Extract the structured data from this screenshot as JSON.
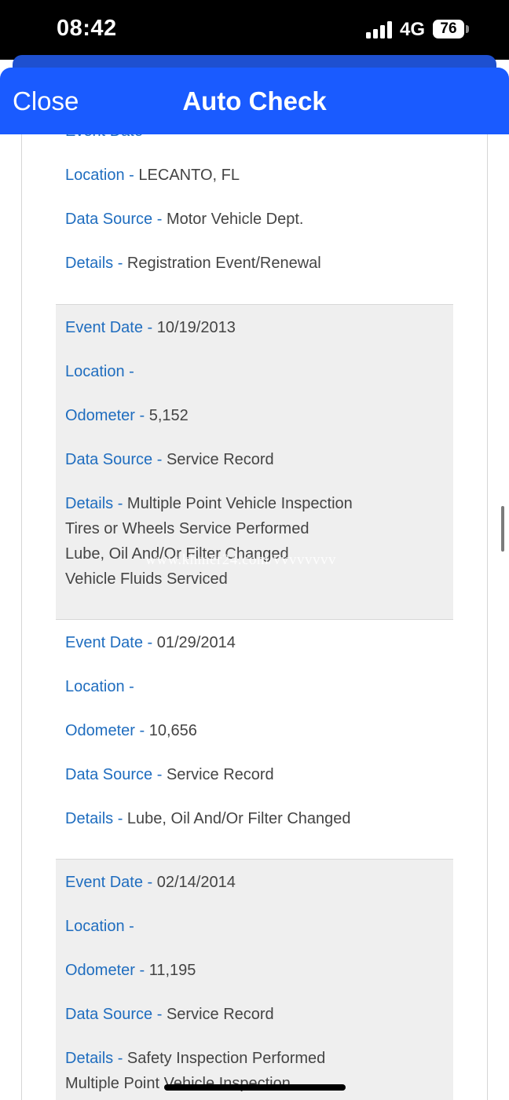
{
  "status_bar": {
    "time": "08:42",
    "network": "4G",
    "battery": "76"
  },
  "header": {
    "close_label": "Close",
    "title": "Auto Check"
  },
  "labels": {
    "event_date": "Event Date -",
    "location": "Location -",
    "odometer": "Odometer -",
    "data_source": "Data Source -",
    "details": "Details -"
  },
  "records": [
    {
      "event_date": "",
      "location": "LECANTO, FL",
      "data_source": "Motor Vehicle Dept.",
      "details": [
        "Registration Event/Renewal"
      ]
    },
    {
      "event_date": "10/19/2013",
      "location": "",
      "odometer": "5,152",
      "data_source": "Service Record",
      "details": [
        "Multiple Point Vehicle Inspection",
        "Tires or Wheels Service Performed",
        "Lube, Oil And/Or Filter Changed",
        "Vehicle Fluids Serviced"
      ]
    },
    {
      "event_date": "01/29/2014",
      "location": "",
      "odometer": "10,656",
      "data_source": "Service Record",
      "details": [
        "Lube, Oil And/Or Filter Changed"
      ]
    },
    {
      "event_date": "02/14/2014",
      "location": "",
      "odometer": "11,195",
      "data_source": "Service Record",
      "details": [
        "Safety Inspection Performed",
        "Multiple Point Vehicle Inspection"
      ]
    }
  ],
  "watermark": "www.khmer24.com/vvvvvvvv"
}
